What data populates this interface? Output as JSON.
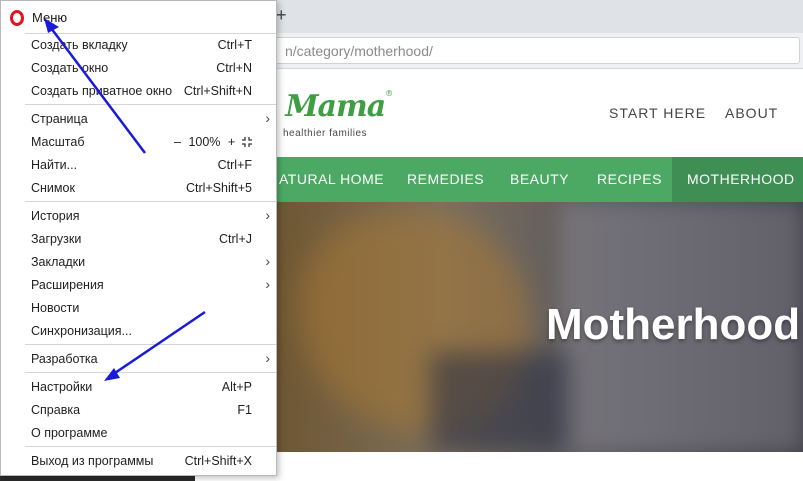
{
  "browser": {
    "new_tab_symbol": "+",
    "url_text": "n/category/motherhood/"
  },
  "site": {
    "logo_text": "s Mama",
    "logo_mark": "®",
    "tagline": "healthier families",
    "top_nav": [
      "START HERE",
      "ABOUT"
    ],
    "main_nav": [
      "ATURAL HOME",
      "REMEDIES",
      "BEAUTY",
      "RECIPES",
      "MOTHERHOOD"
    ],
    "active_nav": "MOTHERHOOD",
    "hero_title": "Motherhood",
    "brand_color": "#4ca964"
  },
  "menu": {
    "title": "Меню",
    "items": [
      {
        "label": "Создать вкладку",
        "shortcut": "Ctrl+T"
      },
      {
        "label": "Создать окно",
        "shortcut": "Ctrl+N"
      },
      {
        "label": "Создать приватное окно",
        "shortcut": "Ctrl+Shift+N"
      },
      {
        "label": "Страница",
        "shortcut": ""
      },
      {
        "label": "Масштаб",
        "shortcut": ""
      },
      {
        "label": "Найти...",
        "shortcut": "Ctrl+F"
      },
      {
        "label": "Снимок",
        "shortcut": "Ctrl+Shift+5"
      },
      {
        "label": "История",
        "shortcut": ""
      },
      {
        "label": "Загрузки",
        "shortcut": "Ctrl+J"
      },
      {
        "label": "Закладки",
        "shortcut": ""
      },
      {
        "label": "Расширения",
        "shortcut": ""
      },
      {
        "label": "Новости",
        "shortcut": ""
      },
      {
        "label": "Синхронизация...",
        "shortcut": ""
      },
      {
        "label": "Разработка",
        "shortcut": ""
      },
      {
        "label": "Настройки",
        "shortcut": "Alt+P"
      },
      {
        "label": "Справка",
        "shortcut": "F1"
      },
      {
        "label": "О программе",
        "shortcut": ""
      },
      {
        "label": "Выход из программы",
        "shortcut": "Ctrl+Shift+X"
      }
    ],
    "zoom": {
      "minus": "–",
      "value": "100%",
      "plus": "+"
    },
    "submenu_arrow": "›",
    "annotation_color": "#1a1adb"
  }
}
